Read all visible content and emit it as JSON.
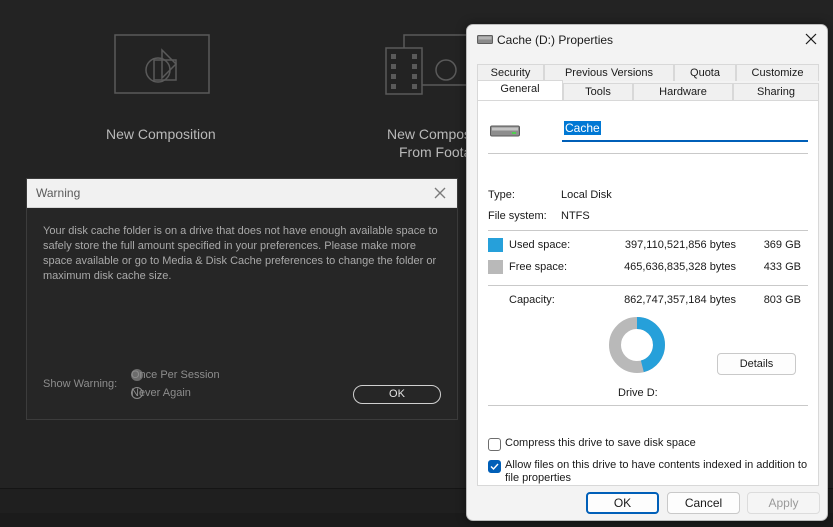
{
  "background": {
    "cards": [
      {
        "label_line1": "New Composition",
        "label_line2": ""
      },
      {
        "label_line1": "New Compos",
        "label_line2": "From Foota"
      }
    ]
  },
  "warning": {
    "title": "Warning",
    "message": "Your disk cache folder is on a drive that does not have enough available space to safely store the full amount specified in your preferences. Please make more space available or go to Media & Disk Cache preferences to change the folder or maximum disk cache size.",
    "show_warning_label": "Show Warning:",
    "options": [
      {
        "label": "Once Per Session",
        "selected": true
      },
      {
        "label": "Never Again",
        "selected": false
      }
    ],
    "ok_label": "OK"
  },
  "properties": {
    "title": "Cache (D:) Properties",
    "tabs_row1": [
      "Security",
      "Previous Versions",
      "Quota",
      "Customize"
    ],
    "tabs_row2": [
      "General",
      "Tools",
      "Hardware",
      "Sharing"
    ],
    "active_tab": "General",
    "drive_name": "Cache",
    "type_label": "Type:",
    "type_value": "Local Disk",
    "fs_label": "File system:",
    "fs_value": "NTFS",
    "used": {
      "label": "Used space:",
      "bytes": "397,110,521,856 bytes",
      "size": "369 GB",
      "color": "#26a0da"
    },
    "free": {
      "label": "Free space:",
      "bytes": "465,636,835,328 bytes",
      "size": "433 GB",
      "color": "#b9b9b9"
    },
    "capacity": {
      "label": "Capacity:",
      "bytes": "862,747,357,184 bytes",
      "size": "803 GB"
    },
    "used_fraction": 0.46,
    "drive_label": "Drive D:",
    "details_label": "Details",
    "compress_label": "Compress this drive to save disk space",
    "compress_checked": false,
    "index_label": "Allow files on this drive to have contents indexed in addition to file properties",
    "index_checked": true,
    "ok_label": "OK",
    "cancel_label": "Cancel",
    "apply_label": "Apply"
  }
}
